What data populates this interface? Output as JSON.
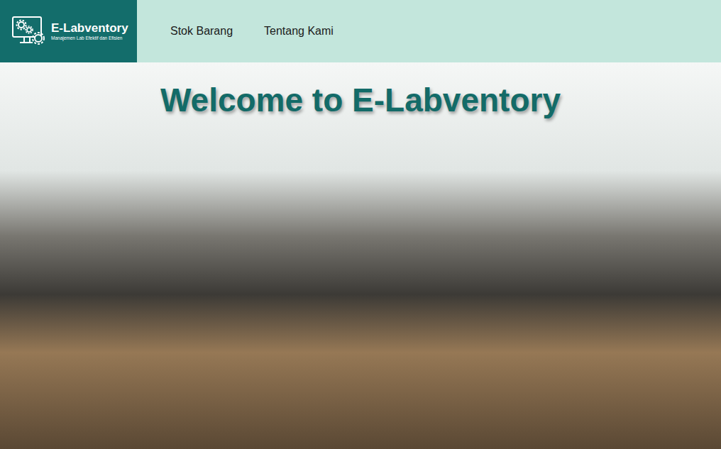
{
  "logo": {
    "title": "E-Labventory",
    "tagline": "Manajemen Lab Efektif dan Efisien"
  },
  "nav": {
    "items": [
      {
        "label": "Stok Barang"
      },
      {
        "label": "Tentang Kami"
      }
    ]
  },
  "hero": {
    "title": "Welcome to E-Labventory"
  }
}
